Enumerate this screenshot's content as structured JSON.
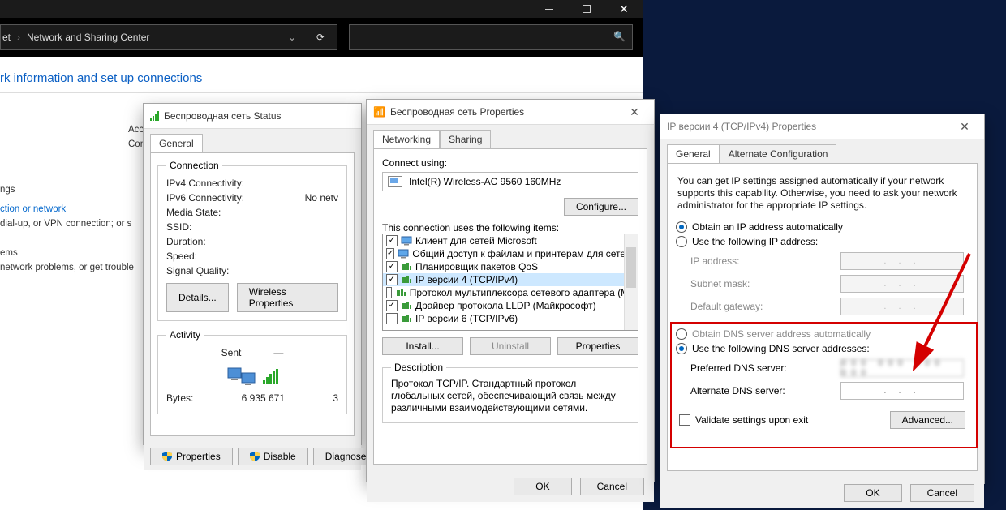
{
  "explorer": {
    "breadcrumb_a": "et",
    "breadcrumb_b": "Network and Sharing Center",
    "heading_fragment": "rk information and set up connections",
    "side": {
      "acc": "Acc",
      "con": "Con",
      "settings_h": "ngs",
      "connect_link": "ction or network",
      "connect_desc": "dial-up, or VPN connection; or s",
      "problems_h": "ems",
      "problems_desc": "network problems, or get trouble"
    }
  },
  "status": {
    "title": "Беспроводная сеть Status",
    "tab_general": "General",
    "group_conn": "Connection",
    "ipv4_lbl": "IPv4 Connectivity:",
    "ipv6_lbl": "IPv6 Connectivity:",
    "ipv6_val": "No netv",
    "media_lbl": "Media State:",
    "ssid_lbl": "SSID:",
    "duration_lbl": "Duration:",
    "speed_lbl": "Speed:",
    "sigq_lbl": "Signal Quality:",
    "details_btn": "Details...",
    "wprops_btn": "Wireless Properties",
    "group_act": "Activity",
    "sent_lbl": "Sent",
    "bytes_lbl": "Bytes:",
    "bytes_sent": "6 935 671",
    "bytes_recv_trunc": "3",
    "btn_props": "Properties",
    "btn_disable": "Disable",
    "btn_diag": "Diagnose"
  },
  "props": {
    "title": "Беспроводная сеть Properties",
    "tab_net": "Networking",
    "tab_share": "Sharing",
    "connect_using": "Connect using:",
    "adapter": "Intel(R) Wireless-AC 9560 160MHz",
    "configure": "Configure...",
    "uses_label": "This connection uses the following items:",
    "items": [
      {
        "checked": true,
        "icon": "client",
        "label": "Клиент для сетей Microsoft"
      },
      {
        "checked": true,
        "icon": "client",
        "label": "Общий доступ к файлам и принтерам для сетей Mi"
      },
      {
        "checked": true,
        "icon": "proto",
        "label": "Планировщик пакетов QoS"
      },
      {
        "checked": true,
        "icon": "proto",
        "label": "IP версии 4 (TCP/IPv4)",
        "selected": true
      },
      {
        "checked": false,
        "icon": "proto",
        "label": "Протокол мультиплексора сетевого адаптера (Ма"
      },
      {
        "checked": true,
        "icon": "proto",
        "label": "Драйвер протокола LLDP (Майкрософт)"
      },
      {
        "checked": false,
        "icon": "proto",
        "label": "IP версии 6 (TCP/IPv6)"
      }
    ],
    "install": "Install...",
    "uninstall": "Uninstall",
    "properties": "Properties",
    "desc_h": "Description",
    "desc_body": "Протокол TCP/IP. Стандартный протокол глобальных сетей, обеспечивающий связь между различными взаимодействующими сетями.",
    "ok": "OK",
    "cancel": "Cancel"
  },
  "ipv4": {
    "title": "IP версии 4 (TCP/IPv4) Properties",
    "tab_general": "General",
    "tab_alt": "Alternate Configuration",
    "desc": "You can get IP settings assigned automatically if your network supports this capability. Otherwise, you need to ask your network administrator for the appropriate IP settings.",
    "r_auto_ip": "Obtain an IP address automatically",
    "r_manual_ip": "Use the following IP address:",
    "ip_lbl": "IP address:",
    "mask_lbl": "Subnet mask:",
    "gw_lbl": "Default gateway:",
    "r_auto_dns": "Obtain DNS server address automatically",
    "r_manual_dns": "Use the following DNS server addresses:",
    "pref_dns_lbl": "Preferred DNS server:",
    "alt_dns_lbl": "Alternate DNS server:",
    "validate": "Validate settings upon exit",
    "advanced": "Advanced...",
    "ok": "OK",
    "cancel": "Cancel",
    "dot_placeholder": ".   .   ."
  }
}
